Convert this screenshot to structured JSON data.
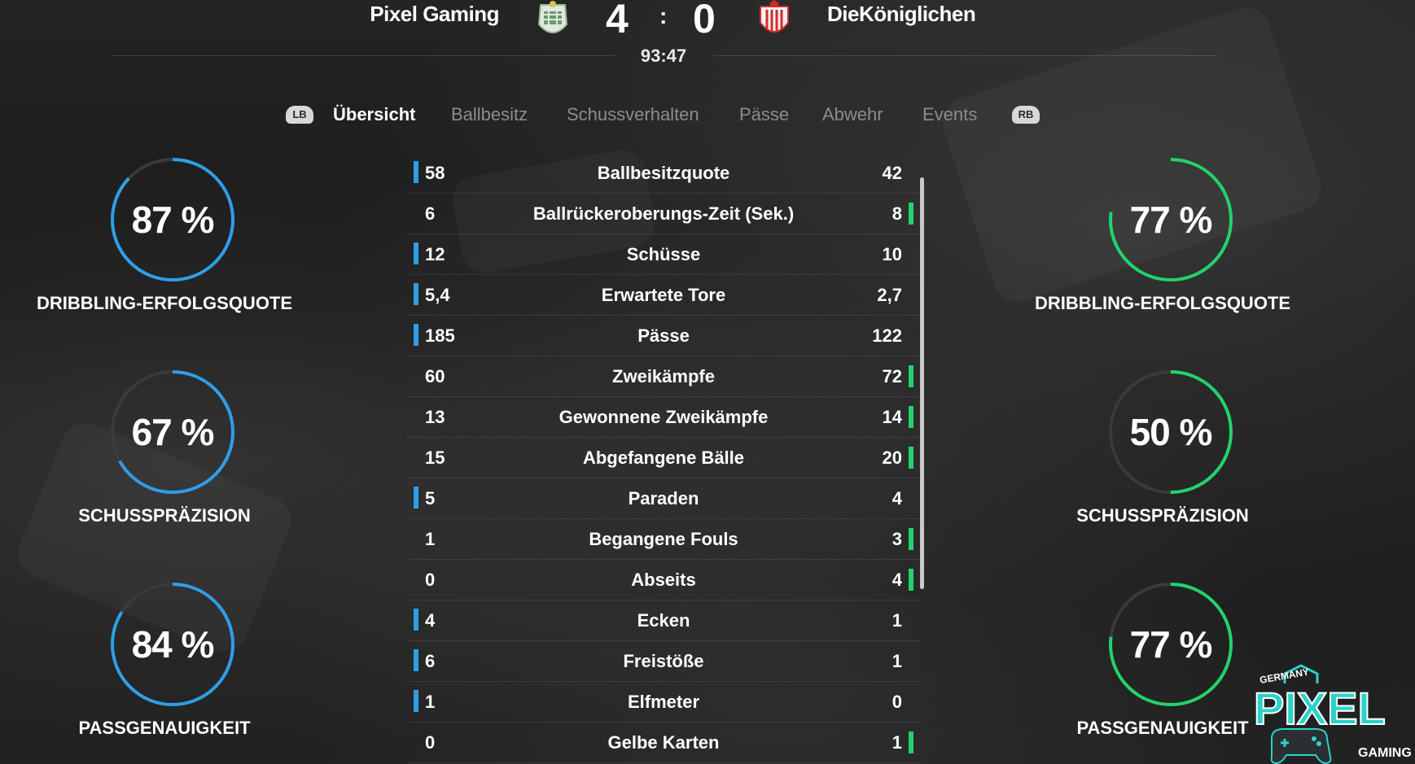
{
  "header": {
    "home_team": "Pixel Gaming",
    "away_team": "DieKöniglichen",
    "home_score": "4",
    "away_score": "0",
    "score_separator": ":",
    "clock": "93:47",
    "home_color": "#2f9ee8",
    "away_color": "#22d36b"
  },
  "tabs": {
    "left_bumper": "LB",
    "right_bumper": "RB",
    "items": [
      "Übersicht",
      "Ballbesitz",
      "Schussverhalten",
      "Pässe",
      "Abwehr",
      "Events"
    ],
    "active": "Übersicht"
  },
  "home_rings": [
    {
      "value": 87,
      "display": "87 %",
      "label": "DRIBBLING-ERFOLGSQUOTE"
    },
    {
      "value": 67,
      "display": "67 %",
      "label": "SCHUSSPRÄZISION"
    },
    {
      "value": 84,
      "display": "84 %",
      "label": "PASSGENAUIGKEIT"
    }
  ],
  "away_rings": [
    {
      "value": 77,
      "display": "77 %",
      "label": "DRIBBLING-ERFOLGSQUOTE"
    },
    {
      "value": 50,
      "display": "50 %",
      "label": "SCHUSSPRÄZISION"
    },
    {
      "value": 77,
      "display": "77 %",
      "label": "PASSGENAUIGKEIT"
    }
  ],
  "stats": [
    {
      "name": "Ballbesitzquote",
      "home": "58",
      "away": "42",
      "leader": "home"
    },
    {
      "name": "Ballrückeroberungs-Zeit (Sek.)",
      "home": "6",
      "away": "8",
      "leader": "away"
    },
    {
      "name": "Schüsse",
      "home": "12",
      "away": "10",
      "leader": "home"
    },
    {
      "name": "Erwartete Tore",
      "home": "5,4",
      "away": "2,7",
      "leader": "home"
    },
    {
      "name": "Pässe",
      "home": "185",
      "away": "122",
      "leader": "home"
    },
    {
      "name": "Zweikämpfe",
      "home": "60",
      "away": "72",
      "leader": "away"
    },
    {
      "name": "Gewonnene Zweikämpfe",
      "home": "13",
      "away": "14",
      "leader": "away"
    },
    {
      "name": "Abgefangene Bälle",
      "home": "15",
      "away": "20",
      "leader": "away"
    },
    {
      "name": "Paraden",
      "home": "5",
      "away": "4",
      "leader": "home"
    },
    {
      "name": "Begangene Fouls",
      "home": "1",
      "away": "3",
      "leader": "away"
    },
    {
      "name": "Abseits",
      "home": "0",
      "away": "4",
      "leader": "away"
    },
    {
      "name": "Ecken",
      "home": "4",
      "away": "1",
      "leader": "home"
    },
    {
      "name": "Freistöße",
      "home": "6",
      "away": "1",
      "leader": "home"
    },
    {
      "name": "Elfmeter",
      "home": "1",
      "away": "0",
      "leader": "home"
    },
    {
      "name": "Gelbe Karten",
      "home": "0",
      "away": "1",
      "leader": "away"
    }
  ],
  "watermark": {
    "top": "GERMANY",
    "main": "PIXEL",
    "bottom": "GAMING"
  }
}
